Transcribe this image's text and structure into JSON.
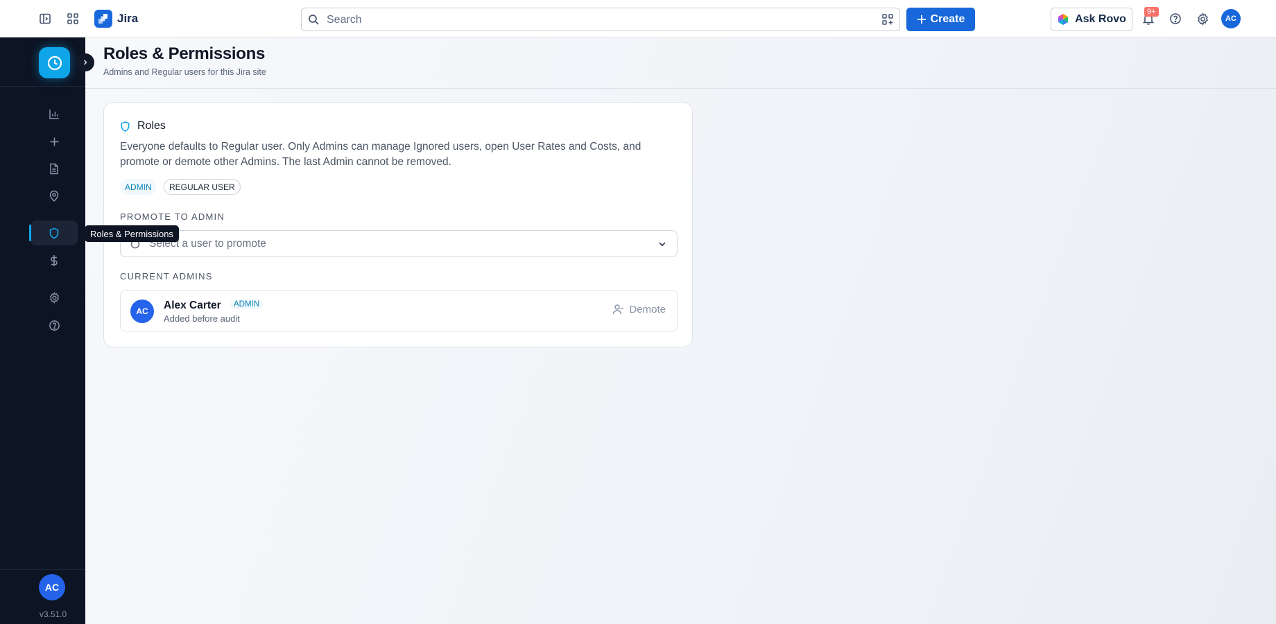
{
  "topbar": {
    "app_name": "Jira",
    "search_placeholder": "Search",
    "create_label": "Create",
    "ask_rovo_label": "Ask Rovo",
    "notifications_badge": "9+",
    "avatar_initials": "AC",
    "brand_color": "#1868db"
  },
  "sidebar": {
    "items": [
      {
        "name": "reports",
        "icon": "bar-chart-icon"
      },
      {
        "name": "add",
        "icon": "plus-icon"
      },
      {
        "name": "documents",
        "icon": "document-icon"
      },
      {
        "name": "locations",
        "icon": "map-pin-icon"
      },
      {
        "name": "roles-permissions",
        "icon": "shield-icon",
        "active": true
      },
      {
        "name": "rates",
        "icon": "dollar-icon"
      },
      {
        "name": "settings",
        "icon": "gear-icon"
      },
      {
        "name": "help",
        "icon": "help-circle-icon"
      }
    ],
    "avatar_initials": "AC",
    "version": "v3.51.0",
    "tooltip": "Roles & Permissions",
    "accent_color": "#0ea5e9"
  },
  "page": {
    "title": "Roles & Permissions",
    "subtitle": "Admins and Regular users for this Jira site"
  },
  "roles_card": {
    "title": "Roles",
    "description": "Everyone defaults to Regular user. Only Admins can manage Ignored users, open User Rates and Costs, and promote or demote other Admins. The last Admin cannot be removed.",
    "role_pills": [
      "ADMIN",
      "REGULAR USER"
    ],
    "promote_label": "PROMOTE TO ADMIN",
    "promote_placeholder": "Select a user to promote",
    "current_admins_label": "CURRENT ADMINS",
    "admins": [
      {
        "initials": "AC",
        "name": "Alex Carter",
        "badge": "ADMIN",
        "note": "Added before audit",
        "action": "Demote"
      }
    ]
  }
}
